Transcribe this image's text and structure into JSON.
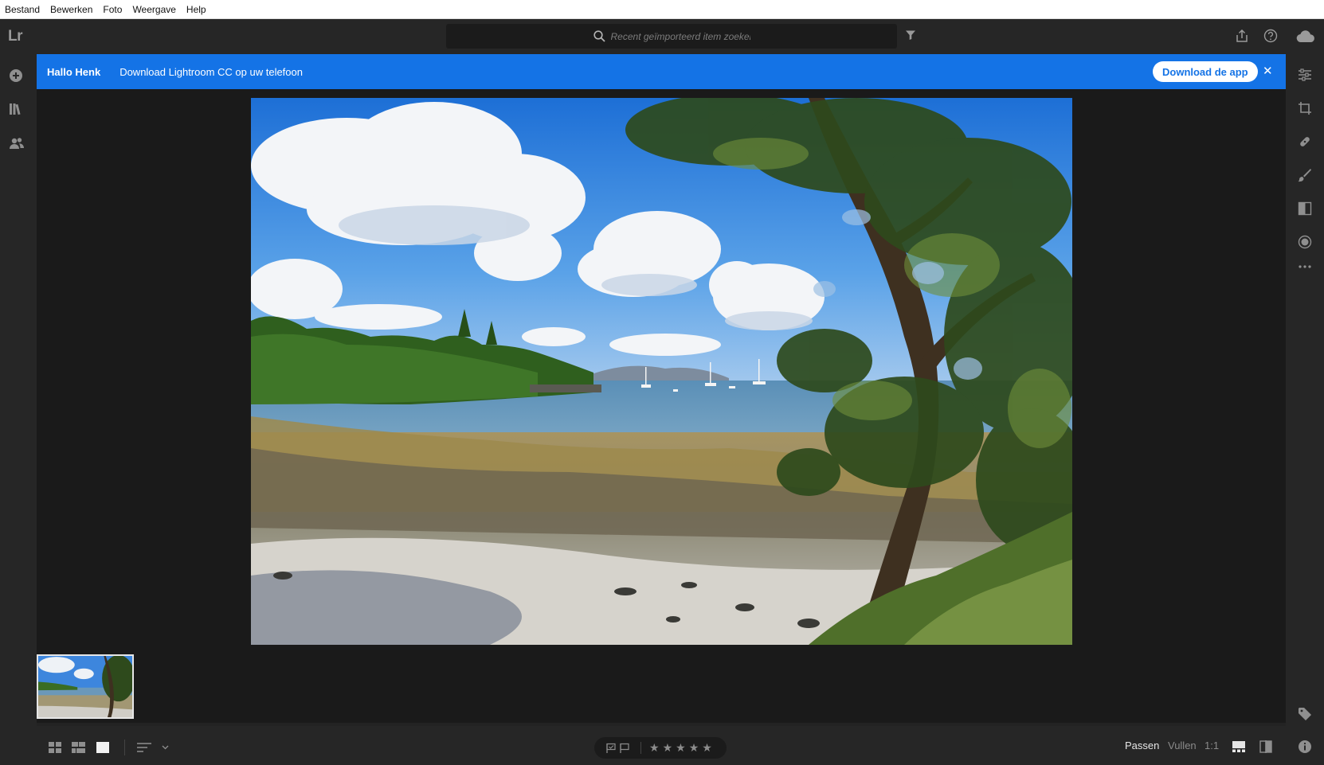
{
  "menu": [
    "Bestand",
    "Bewerken",
    "Foto",
    "Weergave",
    "Help"
  ],
  "app": {
    "logo": "Lr"
  },
  "search": {
    "placeholder": "Recent geïmporteerd item zoeken"
  },
  "banner": {
    "greeting": "Hallo Henk",
    "message": "Download Lightroom CC op uw telefoon",
    "button": "Download de app",
    "close": "✕"
  },
  "left_rail": [
    {
      "name": "add-photos-icon"
    },
    {
      "name": "library-icon"
    },
    {
      "name": "people-icon"
    }
  ],
  "right_rail": [
    {
      "name": "edit-sliders-icon"
    },
    {
      "name": "crop-icon"
    },
    {
      "name": "healing-icon"
    },
    {
      "name": "brush-icon"
    },
    {
      "name": "linear-gradient-icon"
    },
    {
      "name": "radial-gradient-icon"
    },
    {
      "name": "more-icon"
    },
    {
      "name": "keyword-tag-icon"
    },
    {
      "name": "info-icon"
    }
  ],
  "bottom": {
    "views": [
      "square-grid-icon",
      "photo-grid-icon",
      "detail-view-icon"
    ],
    "sort": "sort-icon",
    "stars": [
      "★",
      "★",
      "★",
      "★",
      "★"
    ],
    "zoom": {
      "fit": "Passen",
      "fill": "Vullen",
      "one_to_one": "1:1"
    }
  },
  "colors": {
    "accent": "#1473e6",
    "panel": "#262626",
    "canvas": "#1a1a1a"
  }
}
